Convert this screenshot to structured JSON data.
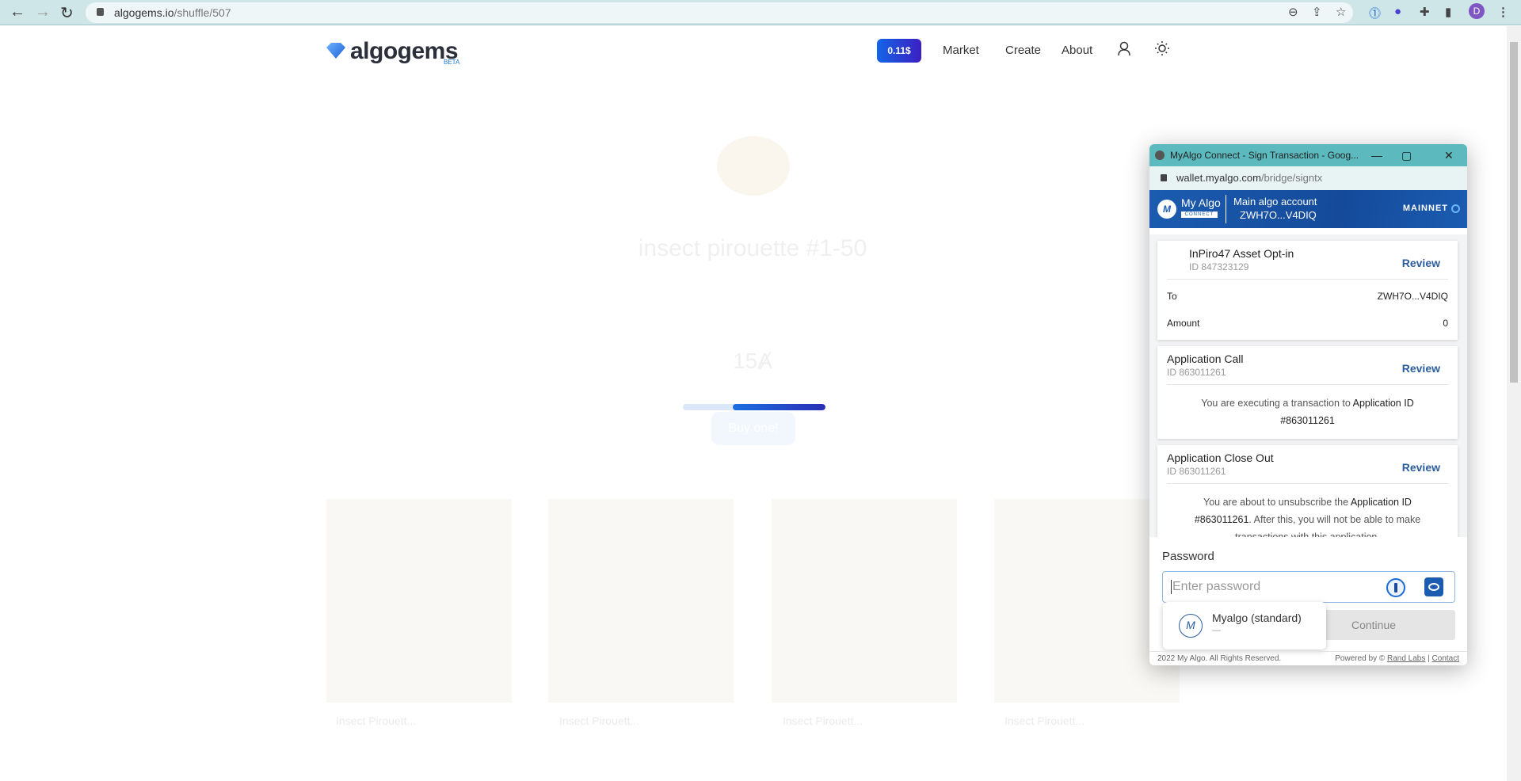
{
  "browser": {
    "url_host": "algogems.io",
    "url_path": "/shuffle/507",
    "profile_initial": "D"
  },
  "site": {
    "logo": "algogems",
    "beta": "BETA",
    "price_badge": "0.11$",
    "nav": [
      "Market",
      "Create",
      "About"
    ],
    "collection_title": "insect pirouette #1-50",
    "price": "15Ⱥ",
    "buy_label": "Buy one!",
    "progress_percent": 65,
    "cards": [
      "Insect Pirouett...",
      "Insect Pirouett...",
      "Insect Pirouett...",
      "Insect Pirouett..."
    ]
  },
  "popup": {
    "window_title": "MyAlgo Connect - Sign Transaction - Goog...",
    "url_host": "wallet.myalgo.com",
    "url_path": "/bridge/signtx",
    "brand": "My Algo",
    "brand_sub": "CONNECT",
    "account_name": "Main algo account",
    "account_addr": "ZWH7O...V4DIQ",
    "network": "MAINNET",
    "transactions": [
      {
        "name": "InPiro47 Asset Opt-in",
        "id": "ID 847323129",
        "review": "Review",
        "to_label": "To",
        "to_value": "ZWH7O...V4DIQ",
        "amount_label": "Amount",
        "amount_value": "0"
      },
      {
        "name": "Application Call",
        "id": "ID 863011261",
        "review": "Review",
        "desc_pre": "You are executing a transaction to ",
        "desc_bold": "Application ID #863011261",
        "desc_post": ""
      },
      {
        "name": "Application Close Out",
        "id": "ID 863011261",
        "review": "Review",
        "desc_pre": "You are about to unsubscribe the ",
        "desc_bold": "Application ID #863011261",
        "desc_post": ". After this, you will not be able to make transactions with this application."
      }
    ],
    "password_label": "Password",
    "password_placeholder": "Enter password",
    "continue_label": "Continue",
    "autofill": {
      "label": "Myalgo (standard)",
      "sub": "—"
    },
    "footer": {
      "copyright": "2022 My Algo. All Rights Reserved.",
      "powered": "Powered by © ",
      "rand_labs": "Rand Labs",
      "sep": " | ",
      "contact": "Contact"
    }
  }
}
